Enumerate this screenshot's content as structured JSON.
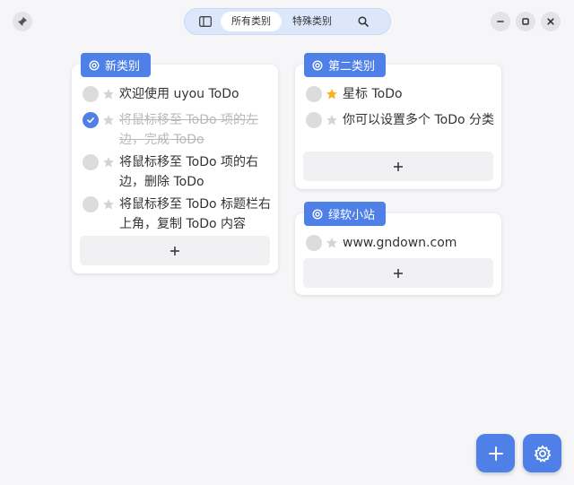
{
  "nav": {
    "tabs": [
      {
        "label": "所有类别",
        "active": true
      },
      {
        "label": "特殊类别",
        "active": false
      }
    ]
  },
  "categories": [
    {
      "name": "新类别",
      "items": [
        {
          "text": "欢迎使用 uyou ToDo",
          "done": false,
          "starred": false
        },
        {
          "text": "将鼠标移至 ToDo 项的左边，完成 ToDo",
          "done": true,
          "starred": false
        },
        {
          "text": "将鼠标移至 ToDo 项的右边，删除 ToDo",
          "done": false,
          "starred": false
        },
        {
          "text": "将鼠标移至 ToDo 标题栏右上角，复制 ToDo 内容",
          "done": false,
          "starred": false
        }
      ],
      "add_label": "+"
    },
    {
      "name": "第二类别",
      "items": [
        {
          "text": "星标 ToDo",
          "done": false,
          "starred": true
        },
        {
          "text": "你可以设置多个 ToDo 分类",
          "done": false,
          "starred": false
        }
      ],
      "add_label": "+"
    },
    {
      "name": "绿软小站",
      "items": [
        {
          "text": "www.gndown.com",
          "done": false,
          "starred": false
        }
      ],
      "add_label": "+"
    }
  ],
  "colors": {
    "accent": "#4e80e8",
    "star_active": "#f5b324",
    "star_inactive": "#d4d4d4"
  },
  "icons": [
    "pin-icon",
    "sidebar-toggle-icon",
    "search-icon",
    "minimize-icon",
    "maximize-icon",
    "close-icon",
    "category-icon",
    "star-icon",
    "check-icon",
    "plus-icon",
    "settings-icon"
  ]
}
